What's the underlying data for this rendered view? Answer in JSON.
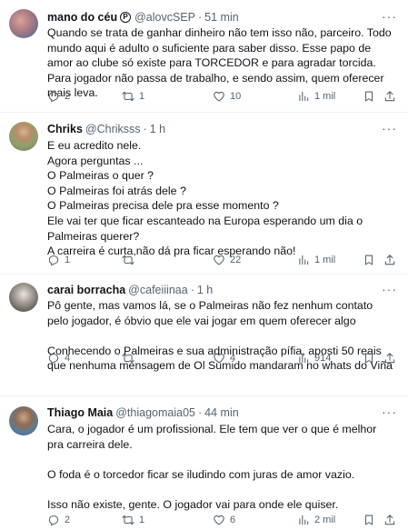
{
  "tweets": [
    {
      "name": "mano do céu",
      "handle": "@alovcSEP",
      "time": "51 min",
      "verified_glyph": "P",
      "avatar": "blurred-photo",
      "lines": [
        "Quando se trata de ganhar dinheiro não tem isso não, parceiro. Todo mundo aqui é adulto o suficiente para saber disso. Esse papo de amor ao clube só existe para TORCEDOR e para agradar torcida. Para jogador não passa de trabalho, e sendo assim, quem oferecer mais leva."
      ],
      "replies": "2",
      "retweets": "1",
      "likes": "10",
      "views": "1 mil"
    },
    {
      "name": "Chriks",
      "handle": "@Chriksss",
      "time": "1 h",
      "avatar": "photo",
      "lines": [
        "E eu acredito nele.",
        "Agora perguntas ...",
        "O Palmeiras o quer ?",
        "O Palmeiras foi atrás dele ?",
        "O Palmeiras precisa dele pra esse momento ?",
        "Ele vai ter que ficar escanteado na Europa esperando um dia o Palmeiras querer?",
        "A carreira é curta,não dá pra ficar esperando não!"
      ],
      "replies": "1",
      "retweets": "",
      "likes": "22",
      "views": "1 mil"
    },
    {
      "name": "carai borracha",
      "handle": "@cafeiiinaa",
      "time": "1 h",
      "avatar": "photo",
      "lines": [
        "Pô gente, mas vamos lá, se o Palmeiras não fez nenhum contato pelo jogador, é óbvio que ele vai jogar em quem oferecer algo",
        "",
        "Conhecendo o Palmeiras e sua administração pífia, aposti 50 reais que nenhuma mensagem de Ol Sumido mandaram no whats do Viña"
      ],
      "replies": "4",
      "retweets": "",
      "likes": "4",
      "views": "914"
    },
    {
      "name": "Thiago Maia",
      "handle": "@thiagomaia05",
      "time": "44 min",
      "avatar": "photo",
      "lines": [
        "Cara, o jogador é um profissional. Ele tem que ver o que é melhor pra carreira dele.",
        "",
        "O foda é o torcedor ficar se iludindo com juras de amor vazio.",
        "",
        "Isso não existe, gente. O jogador vai para onde ele quiser."
      ],
      "replies": "2",
      "retweets": "1",
      "likes": "6",
      "views": "2 mil"
    }
  ],
  "icons": {
    "reply": "reply-icon",
    "retweet": "retweet-icon",
    "like": "heart-icon",
    "views": "views-icon",
    "bookmark": "bookmark-icon",
    "share": "share-icon",
    "more": "more-icon"
  },
  "colors": {
    "text": "#0f1419",
    "muted": "#536471",
    "divider": "#eff3f4"
  }
}
